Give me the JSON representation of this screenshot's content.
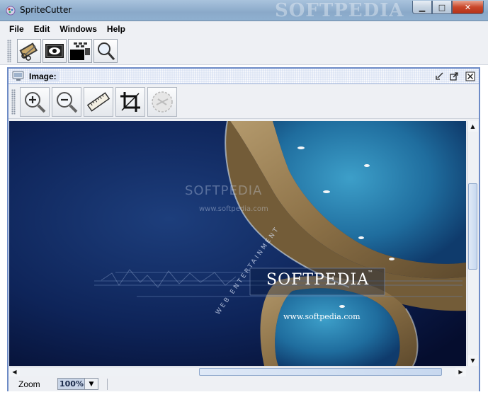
{
  "window": {
    "title": "SpriteCutter",
    "watermark": "SOFTPEDIA",
    "minimize_glyph": "▁",
    "maximize_glyph": "□",
    "close_glyph": "✕"
  },
  "menu": [
    "File",
    "Edit",
    "Windows",
    "Help"
  ],
  "main_toolbar": {
    "icons": [
      "film-scissors-icon",
      "eye-preview-icon",
      "sprite-sheet-icon",
      "magnifier-icon"
    ]
  },
  "image_frame": {
    "title": "Image:",
    "toolbar_icons": [
      "zoom-in-icon",
      "zoom-out-icon",
      "ruler-icon",
      "crop-icon",
      "disabled-cut-icon"
    ]
  },
  "image_content": {
    "brand_small": "SOFTPEDIA",
    "url_small": "www.softpedia.com",
    "brand_large": "SOFTPEDIA",
    "tm": "™",
    "url_large": "www.softpedia.com",
    "tagline": "WEB ENTERTAINMENT"
  },
  "status": {
    "zoom_label": "Zoom",
    "zoom_value": "100%"
  },
  "colors": {
    "frame_border": "#6d8bc6",
    "ocean_dark": "#0b1a44",
    "lagoon": "#2a7fb0"
  }
}
